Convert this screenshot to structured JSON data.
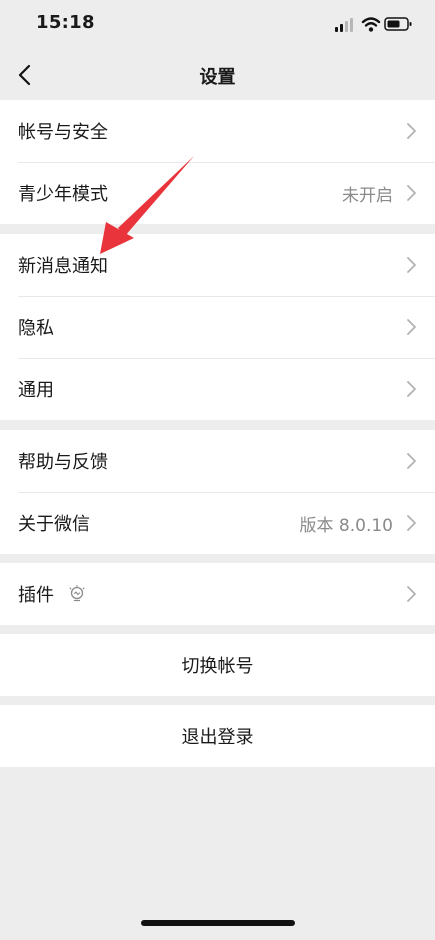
{
  "status_bar": {
    "time": "15:18",
    "icons": [
      "cellular-signal-icon",
      "wifi-icon",
      "battery-icon"
    ]
  },
  "nav": {
    "title": "设置",
    "back_icon": "chevron-left-icon"
  },
  "groups": [
    {
      "items": [
        {
          "label": "帐号与安全",
          "value": ""
        },
        {
          "label": "青少年模式",
          "value": "未开启"
        }
      ]
    },
    {
      "items": [
        {
          "label": "新消息通知",
          "value": ""
        },
        {
          "label": "隐私",
          "value": ""
        },
        {
          "label": "通用",
          "value": ""
        }
      ]
    },
    {
      "items": [
        {
          "label": "帮助与反馈",
          "value": ""
        },
        {
          "label": "关于微信",
          "value": "版本 8.0.10"
        }
      ]
    },
    {
      "items": [
        {
          "label": "插件",
          "icon": "bulb-icon",
          "value": ""
        }
      ]
    }
  ],
  "actions": {
    "switch_account": "切换帐号",
    "logout": "退出登录"
  },
  "colors": {
    "background": "#ededed",
    "row_background": "#ffffff",
    "secondary_text": "#8a8a8a",
    "annotation_arrow": "#e8343a"
  }
}
